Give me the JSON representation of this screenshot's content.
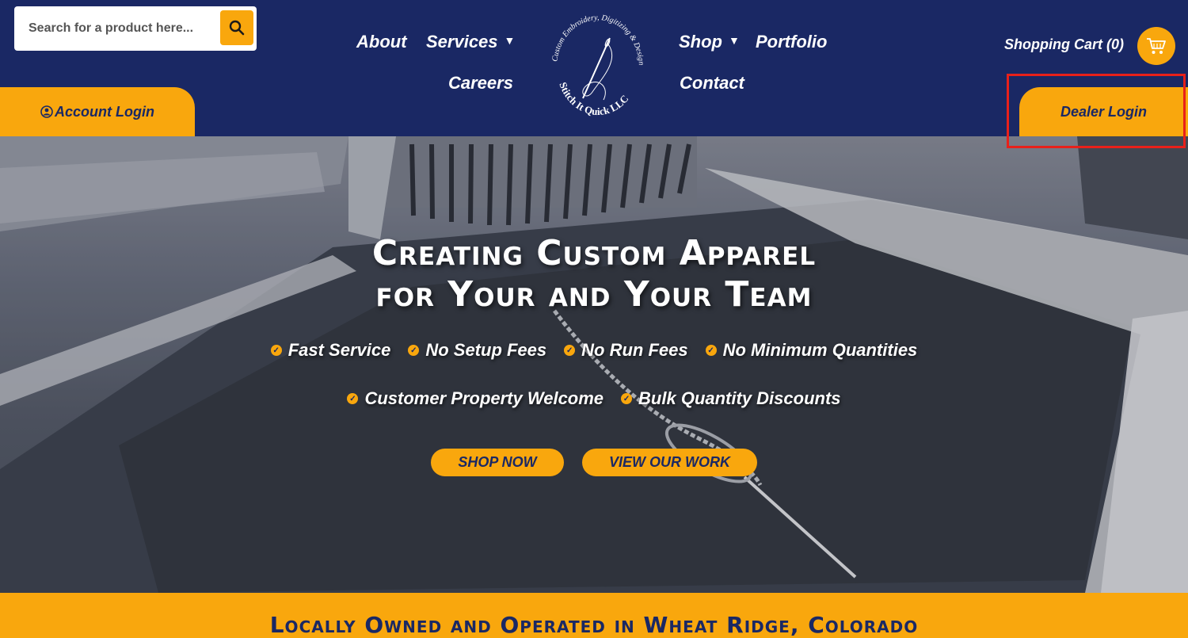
{
  "search": {
    "placeholder": "Search for a product here...",
    "icon": "search-icon"
  },
  "nav": {
    "about": "About",
    "services": "Services",
    "careers": "Careers",
    "shop": "Shop",
    "portfolio": "Portfolio",
    "contact": "Contact",
    "dropdown_caret": "▼"
  },
  "logo": {
    "ring_text": "Custom Embroidery, Digitizing & Design",
    "company": "Stitch It Quick LLC"
  },
  "cart": {
    "label": "Shopping Cart (0)",
    "icon": "shopping-cart-icon"
  },
  "account": {
    "label": "Account Login",
    "icon": "user-circle-icon"
  },
  "dealer": {
    "label": "Dealer Login"
  },
  "hero": {
    "title_line1": "Creating Custom Apparel",
    "title_line2": "for Your and Your Team",
    "features_row1": [
      "Fast Service",
      "No Setup Fees",
      "No Run Fees",
      "No Minimum Quantities"
    ],
    "features_row2": [
      "Customer Property Welcome",
      "Bulk Quantity Discounts"
    ],
    "shop_now": "SHOP NOW",
    "view_work": "VIEW OUR WORK"
  },
  "banner": {
    "text": "Locally Owned and Operated in Wheat Ridge, Colorado"
  },
  "colors": {
    "navy": "#1a2864",
    "accent": "#f9a70d",
    "highlight": "#e8201a"
  }
}
